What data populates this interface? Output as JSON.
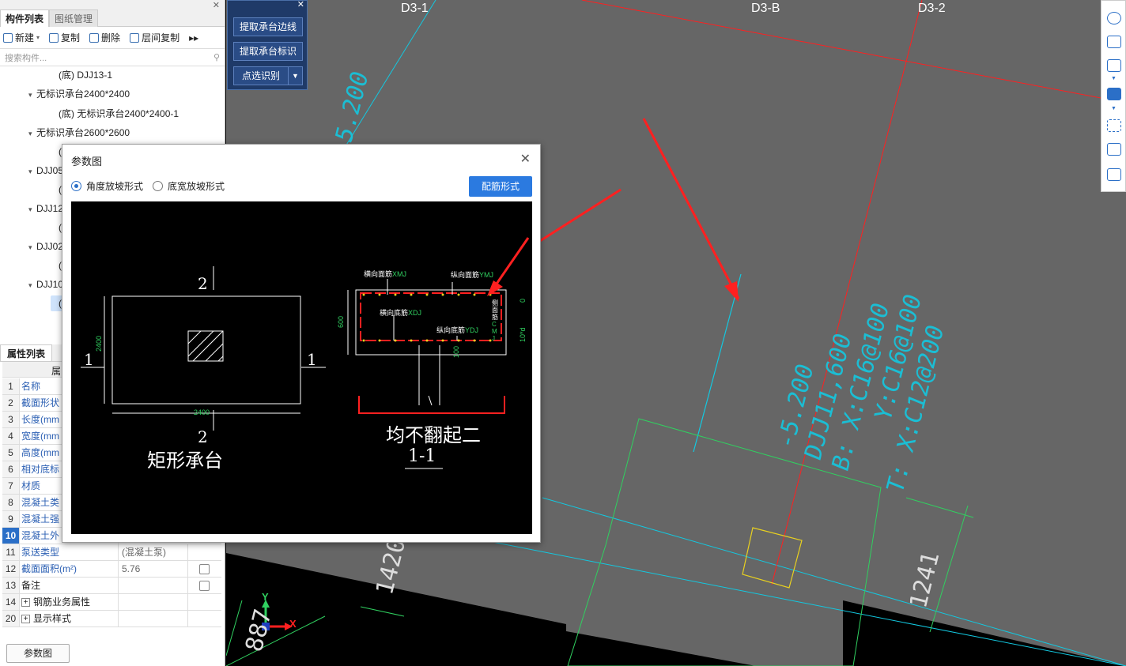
{
  "left_panel": {
    "tabs": [
      "构件列表",
      "图纸管理"
    ],
    "toolbar": {
      "new": "新建",
      "copy": "复制",
      "delete": "删除",
      "floor_copy": "层间复制",
      "more": "▸▸"
    },
    "search_placeholder": "搜索构件...",
    "tree": [
      {
        "label": "(底) DJJ13-1",
        "level": 2
      },
      {
        "label": "无标识承台2400*2400",
        "level": 1
      },
      {
        "label": "(底) 无标识承台2400*2400-1",
        "level": 2
      },
      {
        "label": "无标识承台2600*2600",
        "level": 1
      },
      {
        "label": "(",
        "level": 2
      },
      {
        "label": "DJJ05",
        "level": 1
      },
      {
        "label": "(",
        "level": 2
      },
      {
        "label": "DJJ12",
        "level": 1
      },
      {
        "label": "(",
        "level": 2
      },
      {
        "label": "DJJ02",
        "level": 1
      },
      {
        "label": "(",
        "level": 2
      },
      {
        "label": "DJJ10",
        "level": 1
      },
      {
        "label": "(",
        "level": 2
      }
    ],
    "prop_tab": "属性列表",
    "prop_header": "属",
    "props": [
      {
        "num": "1",
        "name": "名称",
        "value": ""
      },
      {
        "num": "2",
        "name": "截面形状",
        "value": ""
      },
      {
        "num": "3",
        "name": "长度(mm",
        "value": ""
      },
      {
        "num": "4",
        "name": "宽度(mm",
        "value": ""
      },
      {
        "num": "5",
        "name": "高度(mm",
        "value": ""
      },
      {
        "num": "6",
        "name": "相对底标",
        "value": ""
      },
      {
        "num": "7",
        "name": "材质",
        "value": ""
      },
      {
        "num": "8",
        "name": "混凝土类",
        "value": ""
      },
      {
        "num": "9",
        "name": "混凝土强",
        "value": ""
      },
      {
        "num": "10",
        "name": "混凝土外",
        "value": ""
      },
      {
        "num": "11",
        "name": "泵送类型",
        "value": "(混凝土泵)"
      },
      {
        "num": "12",
        "name": "截面面积(m²)",
        "value": "5.76"
      },
      {
        "num": "13",
        "name": "备注",
        "value": ""
      },
      {
        "num": "14",
        "name": "钢筋业务属性",
        "value": ""
      },
      {
        "num": "20",
        "name": "显示样式",
        "value": ""
      }
    ],
    "bottom_button": "参数图"
  },
  "float_panel": {
    "buttons": [
      "提取承台边线",
      "提取承台标识",
      "点选识别"
    ]
  },
  "dialog": {
    "title": "参数图",
    "radio_angle": "角度放坡形式",
    "radio_width": "底宽放坡形式",
    "button": "配筋形式",
    "drawing": {
      "plan_title": "矩形承台",
      "section_title": "均不翻起二",
      "section_label": "1-1",
      "cut_mark_1": "1",
      "cut_mark_2": "2",
      "dim_2400": "2400",
      "dim_600": "600",
      "dim_100": "100",
      "dim_0": "0",
      "dim_10d": "10*d",
      "label_xmj": "横向面筋",
      "code_xmj": "XMJ",
      "label_ymj": "纵向面筋",
      "code_ymj": "YMJ",
      "label_xdj": "横向底筋",
      "code_xdj": "XDJ",
      "label_ydj": "纵向底筋",
      "code_ydj": "YDJ",
      "label_side": "侧面筋",
      "code_side": "CMJ"
    }
  },
  "cad": {
    "axis_labels": [
      "D3-1",
      "D3-B",
      "D3-2"
    ],
    "annotation": [
      "-5.200",
      "DJJ11,600",
      "B: X:C16@100",
      "Y:C16@100",
      "T: X:C12@200"
    ],
    "partial_annotation": "-5.200",
    "dim_1241": "1241",
    "dim_1420": "1420",
    "dim_887": "887",
    "axis_x": "X",
    "axis_y": "Y"
  },
  "colors": {
    "cad_bg": "#666666",
    "accent": "#2b7ae0",
    "cyan": "#13c8e0",
    "green": "#30d060",
    "red": "#ff2020"
  }
}
